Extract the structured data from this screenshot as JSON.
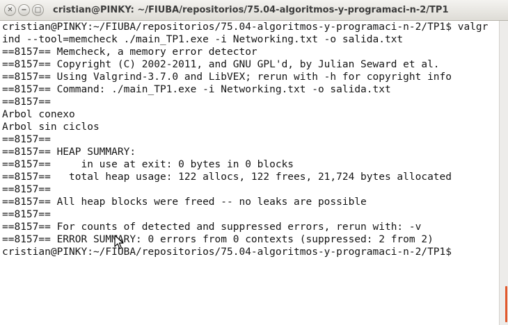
{
  "window": {
    "title": "cristian@PINKY: ~/FIUBA/repositorios/75.04-algoritmos-y-programaci-n-2/TP1",
    "buttons": {
      "close": "✕",
      "minimize": "−",
      "maximize": "□"
    }
  },
  "terminal": {
    "lines": [
      "cristian@PINKY:~/FIUBA/repositorios/75.04-algoritmos-y-programaci-n-2/TP1$ valgr",
      "ind --tool=memcheck ./main_TP1.exe -i Networking.txt -o salida.txt",
      "==8157== Memcheck, a memory error detector",
      "==8157== Copyright (C) 2002-2011, and GNU GPL'd, by Julian Seward et al.",
      "==8157== Using Valgrind-3.7.0 and LibVEX; rerun with -h for copyright info",
      "==8157== Command: ./main_TP1.exe -i Networking.txt -o salida.txt",
      "==8157==",
      "Arbol conexo",
      "Arbol sin ciclos",
      "==8157==",
      "==8157== HEAP SUMMARY:",
      "==8157==     in use at exit: 0 bytes in 0 blocks",
      "==8157==   total heap usage: 122 allocs, 122 frees, 21,724 bytes allocated",
      "==8157==",
      "==8157== All heap blocks were freed -- no leaks are possible",
      "==8157==",
      "==8157== For counts of detected and suppressed errors, rerun with: -v",
      "==8157== ERROR SUMMARY: 0 errors from 0 contexts (suppressed: 2 from 2)",
      "cristian@PINKY:~/FIUBA/repositorios/75.04-algoritmos-y-programaci-n-2/TP1$"
    ]
  },
  "colors": {
    "scroll_thumb": "#e1582b",
    "text": "#141414",
    "background": "#ffffff"
  }
}
